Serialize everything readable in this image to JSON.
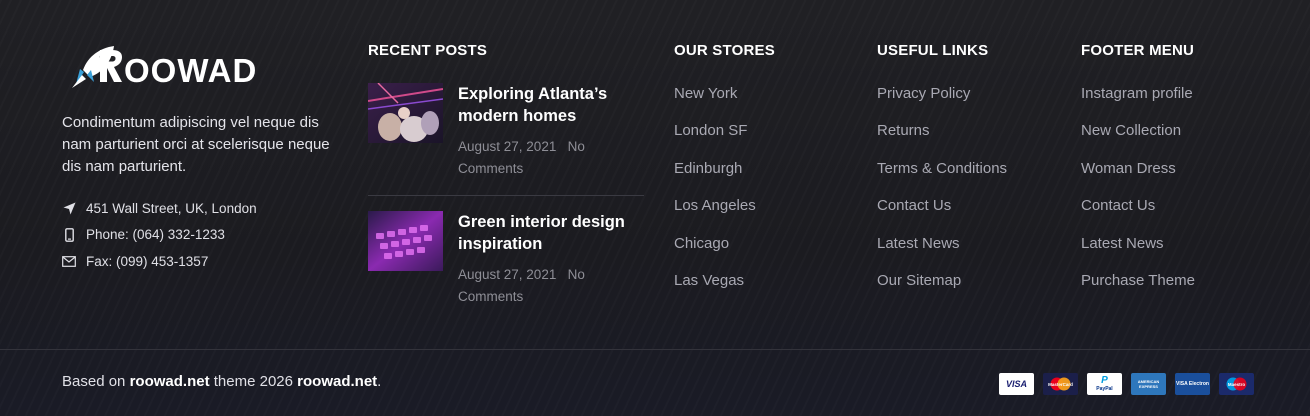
{
  "brand": {
    "name": "ROOWAD",
    "description": "Condimentum adipiscing vel neque dis nam parturient orci at scelerisque neque dis nam parturient."
  },
  "contact": [
    {
      "icon": "location-arrow-icon",
      "text": "451 Wall Street, UK, London"
    },
    {
      "icon": "phone-icon",
      "text": "Phone: (064) 332-1233"
    },
    {
      "icon": "envelope-icon",
      "text": "Fax: (099) 453-1357"
    }
  ],
  "recent_posts": {
    "title": "RECENT POSTS",
    "items": [
      {
        "title": "Exploring Atlanta’s modern homes",
        "date": "August 27, 2021",
        "comments": "No Comments"
      },
      {
        "title": "Green interior design inspiration",
        "date": "August 27, 2021",
        "comments": "No Comments"
      }
    ]
  },
  "stores": {
    "title": "OUR STORES",
    "items": [
      "New York",
      "London SF",
      "Edinburgh",
      "Los Angeles",
      "Chicago",
      "Las Vegas"
    ]
  },
  "useful_links": {
    "title": "USEFUL LINKS",
    "items": [
      "Privacy Policy",
      "Returns",
      "Terms & Conditions",
      "Contact Us",
      "Latest News",
      "Our Sitemap"
    ]
  },
  "footer_menu": {
    "title": "FOOTER MENU",
    "items": [
      "Instagram profile",
      "New Collection",
      "Woman Dress",
      "Contact Us",
      "Latest News",
      "Purchase Theme"
    ]
  },
  "copyright": {
    "prefix": "Based on",
    "site1": "roowad.net",
    "middle": "theme 2026",
    "site2": "roowad.net",
    "suffix": "."
  },
  "payments": [
    {
      "name": "VISA",
      "bg": "#ffffff",
      "fg": "#1a1f71"
    },
    {
      "name": "MasterCard",
      "bg": "#1b1f4a",
      "fg": "#ffffff"
    },
    {
      "name": "PayPal",
      "bg": "#ffffff",
      "fg": "#003087"
    },
    {
      "name": "AMERICAN EXPRESS",
      "bg": "#2e77bc",
      "fg": "#ffffff"
    },
    {
      "name": "VISA Electron",
      "bg": "#1a4f9c",
      "fg": "#ffffff"
    },
    {
      "name": "Maestro",
      "bg": "#1b2a6b",
      "fg": "#ffffff"
    }
  ],
  "colors": {
    "background": "#1e1e22",
    "heading": "#ffffff",
    "link": "#a9a9b3",
    "divider": "#33333b",
    "logo_accent": "#3aa0d8"
  }
}
